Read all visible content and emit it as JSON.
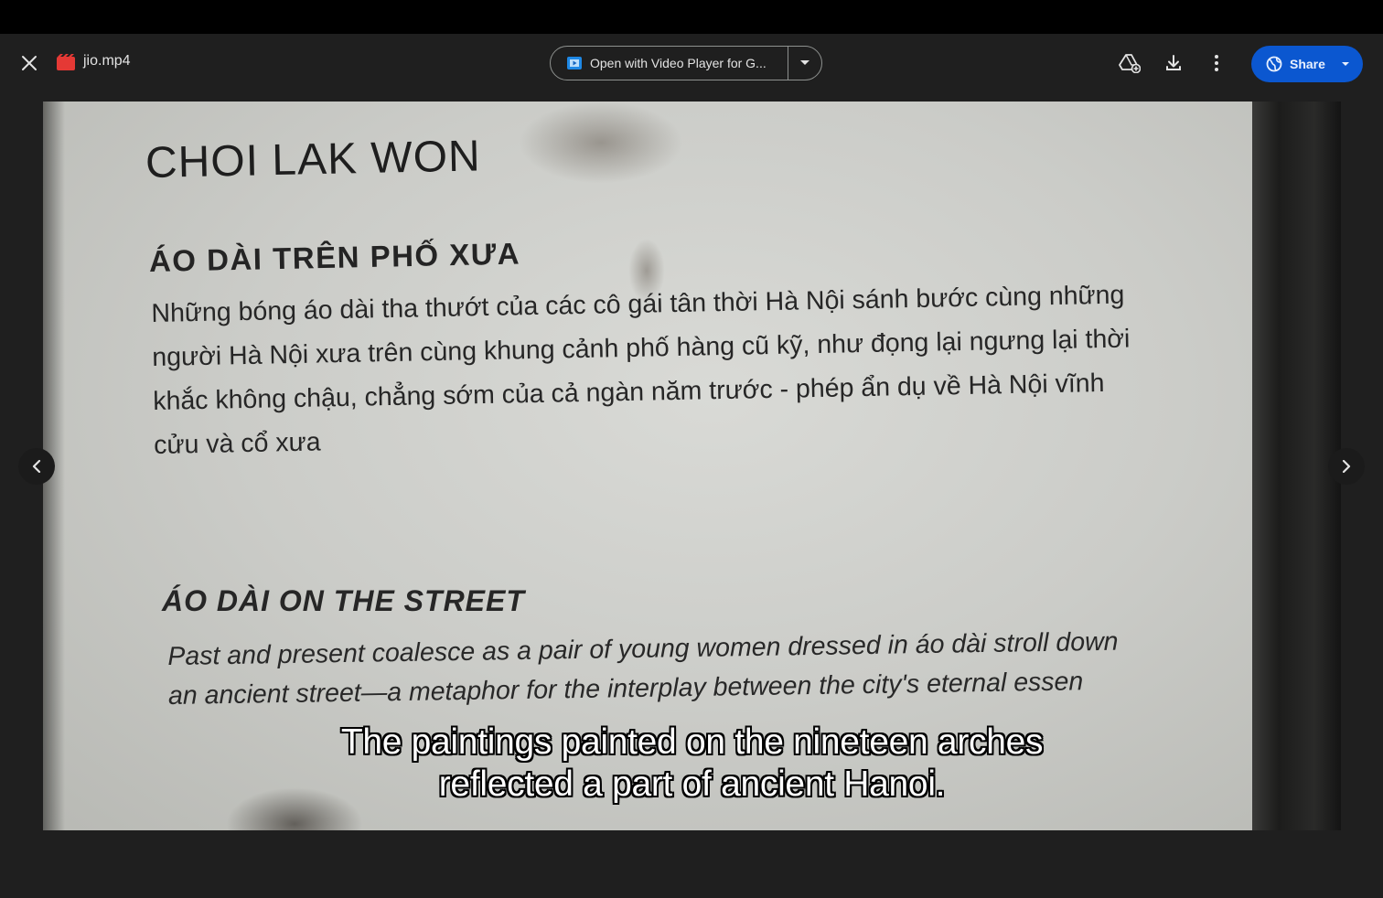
{
  "header": {
    "file_name": "jio.mp4",
    "open_with_label": "Open with Video Player for G...",
    "share_label": "Share"
  },
  "icons": {
    "close": "close-icon",
    "file_type": "video-file-icon",
    "app": "video-player-app-icon",
    "add_to_drive": "add-to-drive-icon",
    "download": "download-icon",
    "more": "more-vert-icon",
    "globe": "globe-icon",
    "prev": "chevron-left-icon",
    "next": "chevron-right-icon"
  },
  "colors": {
    "share_bg": "#0b57d0",
    "file_icon": "#e53935",
    "background": "#1f1f1f"
  },
  "video": {
    "sign_title": "CHOI LAK WON",
    "sign_heading_vn": "ÁO DÀI TRÊN PHỐ XƯA",
    "sign_text_vn": "Những bóng áo dài tha thướt của các cô gái tân thời Hà Nội sánh bước cùng những người Hà Nội xưa trên cùng khung cảnh phố hàng cũ kỹ, như đọng lại ngưng lại thời khắc không chậu, chẳng sớm của cả ngàn năm trước - phép ẩn dụ về Hà Nội vĩnh cửu và cổ xưa",
    "sign_heading_en": "ÁO DÀI ON THE STREET",
    "sign_text_en": "Past and present coalesce as a pair of young women dressed in áo dài stroll down an ancient street—a metaphor for the interplay between the city's eternal essen",
    "subtitle_line1": "The paintings painted on the nineteen arches",
    "subtitle_line2": "reflected a part of ancient Hanoi."
  }
}
